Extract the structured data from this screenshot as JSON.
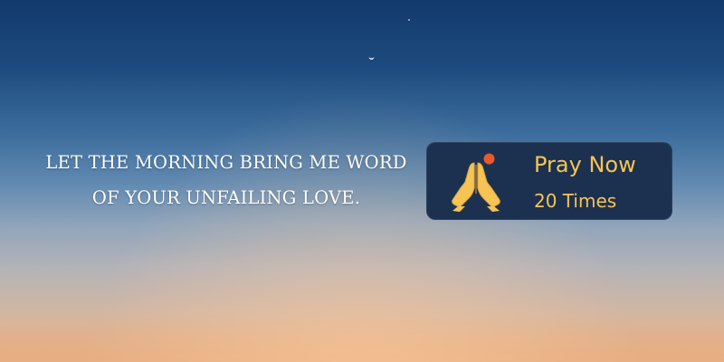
{
  "verse": {
    "line1": "LET THE MORNING BRING ME WORD",
    "line2": "OF YOUR UNFAILING LOVE."
  },
  "pray_card": {
    "label": "Pray Now",
    "count": "20 Times",
    "icon": "praying-hands-icon",
    "notification_dot": true
  },
  "colors": {
    "card_background": "#1c3150",
    "accent_gold": "#f6c454",
    "notification_dot": "#e85a2a",
    "verse_text": "#ffffff"
  }
}
